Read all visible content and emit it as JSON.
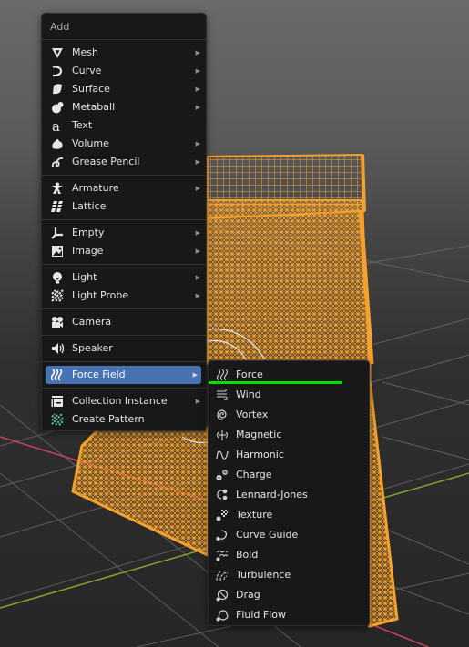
{
  "add_menu": {
    "title": "Add",
    "groups": [
      [
        {
          "label": "Mesh",
          "icon": "mesh-cone-icon",
          "submenu": true
        },
        {
          "label": "Curve",
          "icon": "curve-icon",
          "submenu": true
        },
        {
          "label": "Surface",
          "icon": "surface-icon",
          "submenu": true
        },
        {
          "label": "Metaball",
          "icon": "metaball-icon",
          "submenu": true
        },
        {
          "label": "Text",
          "icon": "text-icon",
          "submenu": false
        },
        {
          "label": "Volume",
          "icon": "volume-icon",
          "submenu": true
        },
        {
          "label": "Grease Pencil",
          "icon": "grease-pencil-icon",
          "submenu": true
        }
      ],
      [
        {
          "label": "Armature",
          "icon": "armature-icon",
          "submenu": true
        },
        {
          "label": "Lattice",
          "icon": "lattice-icon",
          "submenu": false
        }
      ],
      [
        {
          "label": "Empty",
          "icon": "empty-axis-icon",
          "submenu": true
        },
        {
          "label": "Image",
          "icon": "image-icon",
          "submenu": true
        }
      ],
      [
        {
          "label": "Light",
          "icon": "light-bulb-icon",
          "submenu": true
        },
        {
          "label": "Light Probe",
          "icon": "light-probe-icon",
          "submenu": true
        }
      ],
      [
        {
          "label": "Camera",
          "icon": "camera-icon",
          "submenu": false
        }
      ],
      [
        {
          "label": "Speaker",
          "icon": "speaker-icon",
          "submenu": false
        }
      ],
      [
        {
          "label": "Force Field",
          "icon": "force-field-icon",
          "submenu": true,
          "active": true
        }
      ],
      [
        {
          "label": "Collection Instance",
          "icon": "collection-instance-icon",
          "submenu": true
        },
        {
          "label": "Create Pattern",
          "icon": "create-pattern-icon",
          "submenu": false
        }
      ]
    ]
  },
  "force_field_menu": {
    "items": [
      {
        "label": "Force",
        "icon": "force-icon"
      },
      {
        "label": "Wind",
        "icon": "wind-icon"
      },
      {
        "label": "Vortex",
        "icon": "vortex-icon"
      },
      {
        "label": "Magnetic",
        "icon": "magnetic-icon"
      },
      {
        "label": "Harmonic",
        "icon": "harmonic-icon"
      },
      {
        "label": "Charge",
        "icon": "charge-icon"
      },
      {
        "label": "Lennard-Jones",
        "icon": "lennard-jones-icon"
      },
      {
        "label": "Texture",
        "icon": "texture-icon"
      },
      {
        "label": "Curve Guide",
        "icon": "curve-guide-icon"
      },
      {
        "label": "Boid",
        "icon": "boid-icon"
      },
      {
        "label": "Turbulence",
        "icon": "turbulence-icon"
      },
      {
        "label": "Drag",
        "icon": "drag-icon"
      },
      {
        "label": "Fluid Flow",
        "icon": "fluid-flow-icon"
      }
    ]
  },
  "colors": {
    "menu_bg": "#181818",
    "active_item": "#4772b3",
    "selection_orange": "#f5a12d",
    "x_axis": "#c8435a",
    "y_axis": "#7fa82e",
    "highlight_line": "#00e000"
  }
}
